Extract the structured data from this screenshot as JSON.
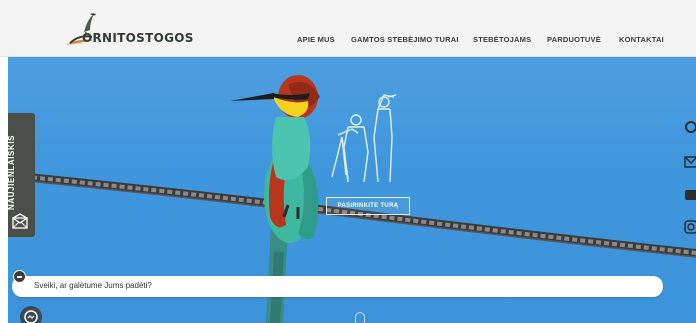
{
  "header": {
    "logo_text": "ORNITOSTOGOS",
    "nav": [
      {
        "label": "APIE MUS"
      },
      {
        "label": "GAMTOS STEBĖJIMO TURAI"
      },
      {
        "label": "STEBĖTOJAMS"
      },
      {
        "label": "PARDUOTUVĖ"
      },
      {
        "label": "KONTAKTAI"
      }
    ]
  },
  "hero": {
    "cta_label": "PASIRINKITE TURĄ"
  },
  "newsletter": {
    "label": "NAUJIENLAIŠKIS",
    "icon": "envelope-icon"
  },
  "social": [
    "search-icon",
    "mail-icon",
    "youtube-icon",
    "instagram-icon"
  ],
  "chat": {
    "message": "Sveiki, ar galėtume Jums padėti?",
    "close_icon": "minus-icon",
    "launcher_icon": "messenger-icon"
  },
  "colors": {
    "sky": "#3f96dc",
    "header_bg": "#f4f4f4",
    "tab_bg": "#4a4f4a",
    "bird_green": "#3fb8a0",
    "bird_yellow": "#f2d21e",
    "bird_red": "#b8361e"
  }
}
